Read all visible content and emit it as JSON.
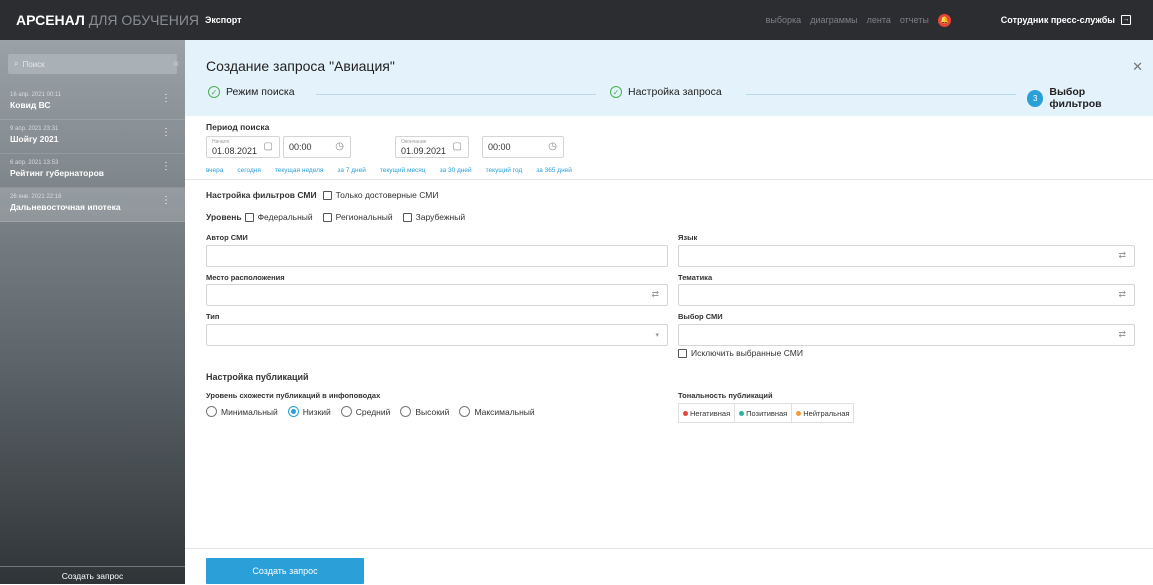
{
  "brand": {
    "main": "АРСЕНАЛ",
    "sub": "ДЛЯ ОБУЧЕНИЯ"
  },
  "topbar": {
    "export": "Экспорт",
    "nav": [
      "выборка",
      "диаграммы",
      "лента",
      "отчеты"
    ],
    "user": "Сотрудник пресс-службы"
  },
  "sidebar": {
    "search_placeholder": "Поиск",
    "items": [
      {
        "date": "16 апр. 2021 00:11",
        "title": "Ковид ВС"
      },
      {
        "date": "9 апр. 2021 23:31",
        "title": "Шойгу 2021"
      },
      {
        "date": "6 апр. 2021 13:53",
        "title": "Рейтинг губернаторов"
      },
      {
        "date": "26 янв. 2021 22:16",
        "title": "Дальневосточная ипотека"
      }
    ],
    "create": "Создать запрос"
  },
  "header": {
    "title": "Создание запроса \"Авиация\"",
    "steps": [
      {
        "label": "Режим поиска"
      },
      {
        "label": "Настройка запроса"
      },
      {
        "num": "3",
        "label": "Выбор фильтров"
      }
    ]
  },
  "period": {
    "label": "Период поиска",
    "start_cap": "Начало",
    "start_date": "01.08.2021",
    "start_time": "00:00",
    "end_cap": "Окончание",
    "end_date": "01.09.2021",
    "end_time": "00:00",
    "quick": [
      "вчера",
      "сегодня",
      "текущая неделя",
      "за 7 дней",
      "текущий месяц",
      "за 30 дней",
      "текущий год",
      "за 365 дней"
    ]
  },
  "filters": {
    "title": "Настройка фильтров СМИ",
    "reliable": "Только достоверные СМИ",
    "level_label": "Уровень",
    "levels": [
      "Федеральный",
      "Региональный",
      "Зарубежный"
    ],
    "author": "Автор СМИ",
    "location": "Место расположения",
    "type": "Тип",
    "language": "Язык",
    "topic": "Тематика",
    "media_choice": "Выбор СМИ",
    "exclude": "Исключить выбранные СМИ"
  },
  "publications": {
    "title": "Настройка публикаций",
    "similarity": "Уровень схожести публикаций в инфоповодах",
    "options": [
      "Минимальный",
      "Низкий",
      "Средний",
      "Высокий",
      "Максимальный"
    ],
    "selected": "Низкий",
    "tonality": "Тональность публикаций",
    "tones": [
      {
        "label": "Негативная",
        "color": "#e8443a"
      },
      {
        "label": "Позитивная",
        "color": "#26b5a0"
      },
      {
        "label": "Нейтральная",
        "color": "#f39c3c"
      }
    ]
  },
  "submit": "Создать запрос"
}
